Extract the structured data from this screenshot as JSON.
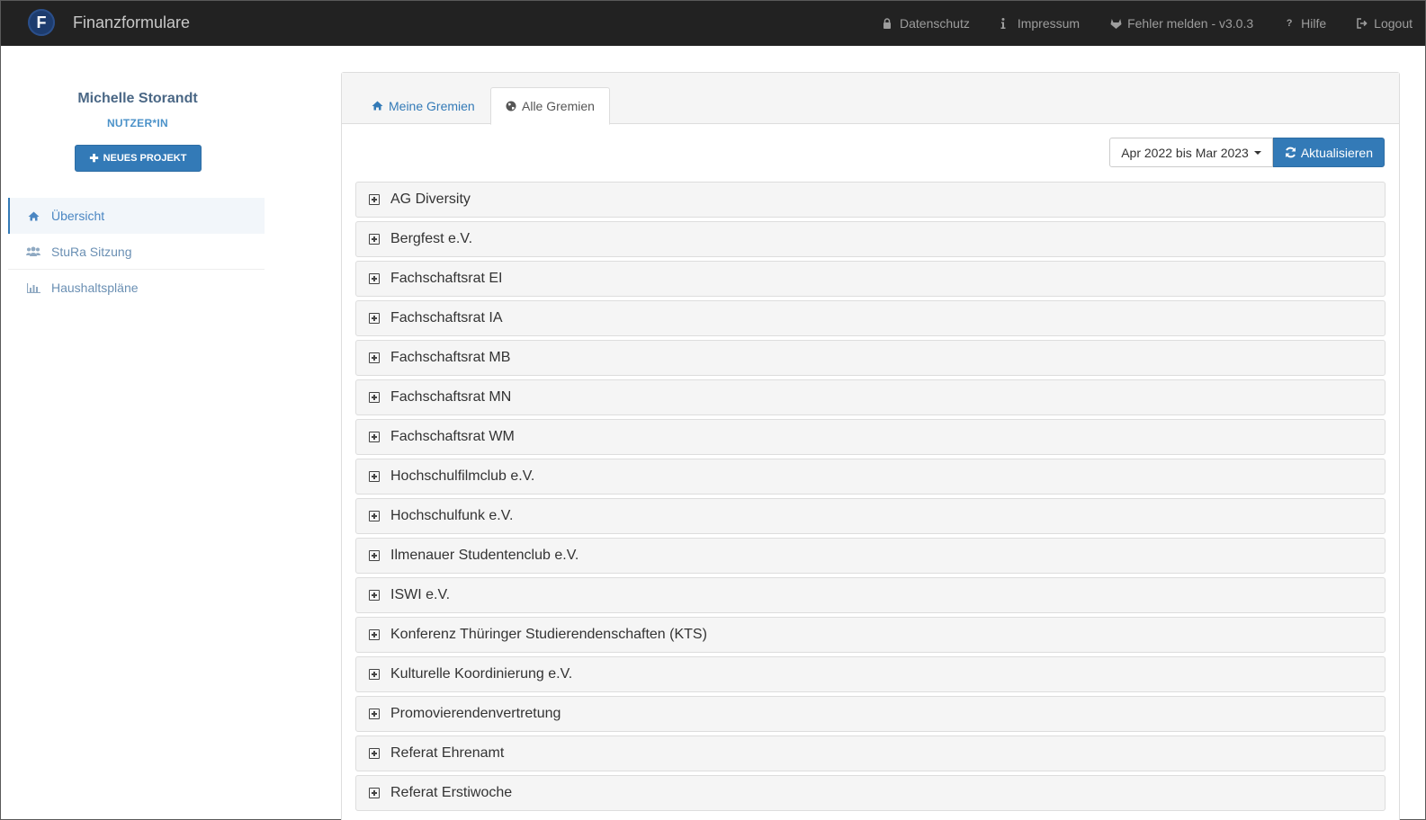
{
  "app": {
    "logo_letter": "F",
    "title": "Finanzformulare"
  },
  "navbar": {
    "links": [
      {
        "label": "Datenschutz",
        "icon": "lock-icon"
      },
      {
        "label": "Impressum",
        "icon": "info-icon"
      },
      {
        "label": "Fehler melden - v3.0.3",
        "icon": "gitlab-icon"
      },
      {
        "label": "Hilfe",
        "icon": "question-icon"
      },
      {
        "label": "Logout",
        "icon": "logout-icon"
      }
    ]
  },
  "user": {
    "name": "Michelle Storandt",
    "role": "NUTZER*IN"
  },
  "sidebar": {
    "new_project_label": "NEUES PROJEKT",
    "items": [
      {
        "label": "Übersicht",
        "icon": "home-icon",
        "active": true
      },
      {
        "label": "StuRa Sitzung",
        "icon": "users-icon",
        "active": false
      },
      {
        "label": "Haushaltspläne",
        "icon": "bar-chart-icon",
        "active": false
      }
    ]
  },
  "tabs": [
    {
      "label": "Meine Gremien",
      "icon": "home-icon",
      "active": false
    },
    {
      "label": "Alle Gremien",
      "icon": "globe-icon",
      "active": true
    }
  ],
  "toolbar": {
    "period": "Apr 2022 bis Mar 2023",
    "refresh_label": "Aktualisieren"
  },
  "gremien": [
    "AG Diversity",
    "Bergfest e.V.",
    "Fachschaftsrat EI",
    "Fachschaftsrat IA",
    "Fachschaftsrat MB",
    "Fachschaftsrat MN",
    "Fachschaftsrat WM",
    "Hochschulfilmclub e.V.",
    "Hochschulfunk e.V.",
    "Ilmenauer Studentenclub e.V.",
    "ISWI e.V.",
    "Konferenz Thüringer Studierendenschaften (KTS)",
    "Kulturelle Koordinierung e.V.",
    "Promovierendenvertretung",
    "Referat Ehrenamt",
    "Referat Erstiwoche"
  ],
  "colors": {
    "navbar_bg": "#222222",
    "primary": "#337ab7",
    "list_bg": "#f5f5f5"
  }
}
